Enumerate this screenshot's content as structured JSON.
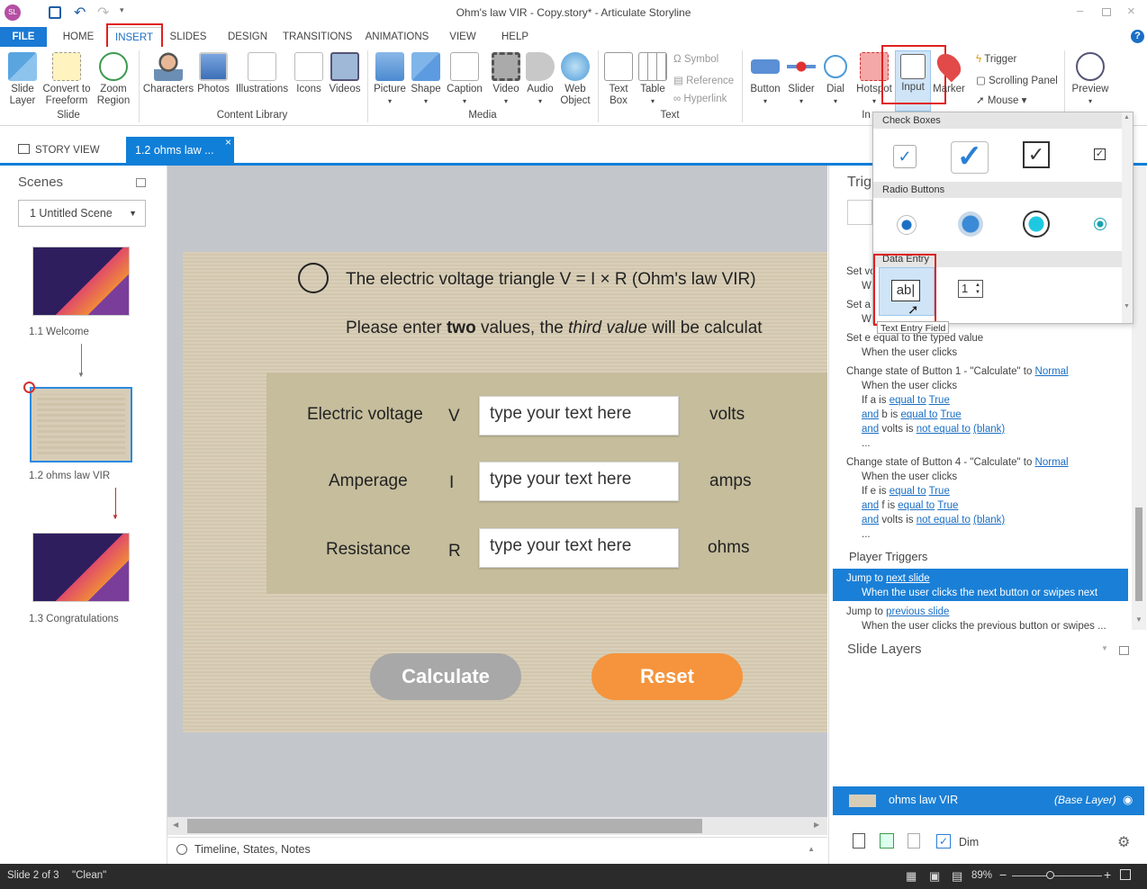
{
  "window": {
    "title": "Ohm's law VIR - Copy.story* - Articulate Storyline",
    "avatar": "SL"
  },
  "menu": {
    "tabs": [
      "FILE",
      "HOME",
      "INSERT",
      "SLIDES",
      "DESIGN",
      "TRANSITIONS",
      "ANIMATIONS",
      "VIEW",
      "HELP"
    ],
    "help": "?"
  },
  "ribbon": {
    "slide_group": {
      "label": "Slide",
      "buttons": [
        "Slide\nLayer",
        "Convert to\nFreeform",
        "Zoom\nRegion"
      ]
    },
    "content_group": {
      "label": "Content Library",
      "buttons": [
        "Characters",
        "Photos",
        "Illustrations",
        "Icons",
        "Videos"
      ]
    },
    "media_group": {
      "label": "Media",
      "buttons": [
        "Picture",
        "Shape",
        "Caption",
        "Video",
        "Audio",
        "Web\nObject"
      ]
    },
    "text_group": {
      "label": "Text",
      "buttons": [
        "Text\nBox",
        "Table"
      ],
      "small": [
        "Symbol",
        "Reference",
        "Hyperlink"
      ]
    },
    "interactive": {
      "label": "In",
      "buttons": [
        "Button",
        "Slider",
        "Dial",
        "Hotspot",
        "Input",
        "Marker"
      ],
      "small": [
        "Trigger",
        "Scrolling Panel",
        "Mouse"
      ],
      "preview": "Preview"
    }
  },
  "doctabs": {
    "story_view": "STORY VIEW",
    "current": "1.2 ohms law ..."
  },
  "scenes": {
    "title": "Scenes",
    "selector": "1 Untitled Scene",
    "slides": [
      {
        "label": "1.1 Welcome"
      },
      {
        "label": "1.2 ohms law VIR"
      },
      {
        "label": "1.3 Congratulations"
      }
    ]
  },
  "slide": {
    "title": "The electric voltage triangle V = I × R (Ohm's law VIR)",
    "subtitle_pre": "Please enter ",
    "subtitle_bold": "two",
    "subtitle_mid": " values, the ",
    "subtitle_italic": "third value",
    "subtitle_post": " will be calculat",
    "rows": [
      {
        "label": "Electric voltage",
        "symbol": "V",
        "placeholder": "type your text here",
        "unit": "volts"
      },
      {
        "label": "Amperage",
        "symbol": "I",
        "placeholder": "type your text here",
        "unit": "amps"
      },
      {
        "label": "Resistance",
        "symbol": "R",
        "placeholder": "type your text here",
        "unit": "ohms"
      }
    ],
    "calculate": "Calculate",
    "reset": "Reset"
  },
  "triggers": {
    "title": "Trig",
    "partial": [
      "Set vo",
      "W",
      "Set a",
      "W"
    ],
    "items": [
      {
        "l1": "Set e equal to the typed value",
        "l2": "When the user clicks"
      },
      {
        "head": "Change state of Button 1 - \"Calculate\" to ",
        "head_link": "Normal",
        "when": "When the user clicks",
        "c1a": "If a is ",
        "c1b": "equal to",
        "c1c": "True",
        "c2a": "and",
        "c2b": " b is ",
        "c2c": "equal to",
        "c2d": "True",
        "c3a": "and",
        "c3b": " volts is ",
        "c3c": "not equal to",
        "c3d": "(blank)",
        "more": "..."
      },
      {
        "head": "Change state of Button 4 - \"Calculate\" to ",
        "head_link": "Normal",
        "when": "When the user clicks",
        "c1a": "If e is ",
        "c1b": "equal to",
        "c1c": "True",
        "c2a": "and",
        "c2b": " f is ",
        "c2c": "equal to",
        "c2d": "True",
        "c3a": "and",
        "c3b": " volts is ",
        "c3c": "not equal to",
        "c3d": "(blank)",
        "more": "..."
      }
    ],
    "player_title": "Player Triggers",
    "player": [
      {
        "pre": "Jump to ",
        "link": "next slide",
        "when": "When the user clicks the next button or swipes next"
      },
      {
        "pre": "Jump to ",
        "link": "previous slide",
        "when": "When the user clicks the previous button or swipes ..."
      }
    ]
  },
  "layers": {
    "title": "Slide Layers",
    "base_name": "ohms law VIR",
    "base_tag": "(Base Layer)",
    "dim": "Dim"
  },
  "dropdown": {
    "checkbox_head": "Check Boxes",
    "radio_head": "Radio Buttons",
    "data_head": "Data Entry",
    "tooltip": "Text Entry Field",
    "textentry_glyph": "ab|",
    "numeric_glyph": "1"
  },
  "bottom": {
    "timeline": "Timeline, States, Notes"
  },
  "status": {
    "slide": "Slide 2 of 3",
    "theme": "\"Clean\"",
    "zoom": "89%"
  },
  "colors": {
    "accent": "#0f7fd8",
    "highlight": "#e02020",
    "calculate": "#a8a8a8",
    "reset": "#f5943c",
    "selected_trigger": "#1a7fd6"
  }
}
